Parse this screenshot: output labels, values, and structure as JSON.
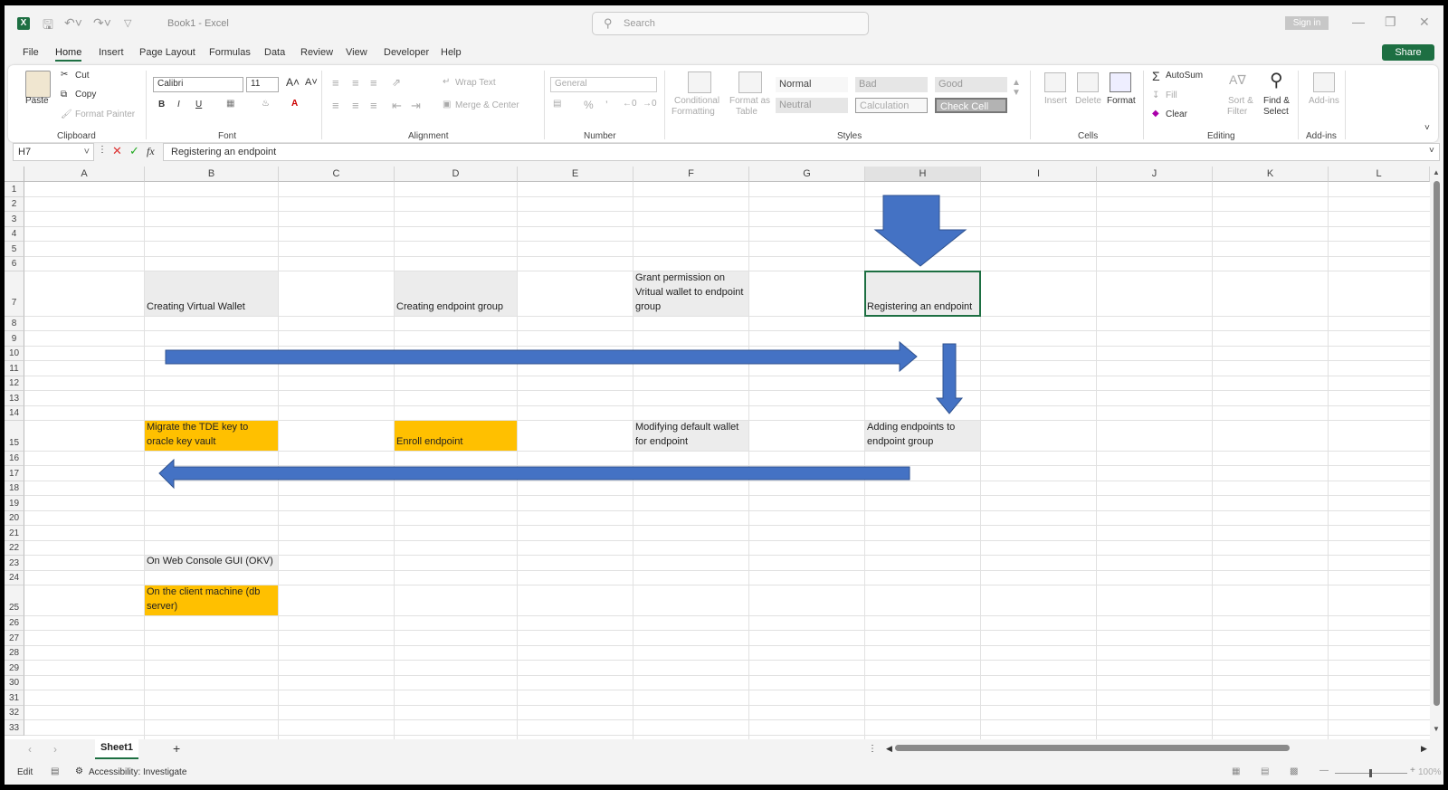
{
  "app": {
    "title": "Book1  -  Excel",
    "logo_letter": "X"
  },
  "search": {
    "placeholder": "Search"
  },
  "account": {
    "signin_label": "Sign in"
  },
  "menu": [
    "File",
    "Home",
    "Insert",
    "Page Layout",
    "Formulas",
    "Data",
    "Review",
    "View",
    "Developer",
    "Help"
  ],
  "share_label": "Share",
  "ribbon": {
    "clipboard": {
      "paste": "Paste",
      "cut": "Cut",
      "copy": "Copy",
      "format_painter": "Format Painter",
      "group": "Clipboard"
    },
    "font": {
      "name": "Calibri",
      "size": "11",
      "group": "Font"
    },
    "alignment": {
      "wrap_text": "Wrap Text",
      "merge_center": "Merge & Center",
      "group": "Alignment"
    },
    "number": {
      "format": "General",
      "group": "Number"
    },
    "styles": {
      "conditional": "Conditional",
      "formatting": "Formatting",
      "format_as": "Format as",
      "table": "Table",
      "normal": "Normal",
      "bad": "Bad",
      "good": "Good",
      "neutral": "Neutral",
      "calculation": "Calculation",
      "check_cell": "Check Cell",
      "group": "Styles"
    },
    "cells": {
      "insert": "Insert",
      "delete": "Delete",
      "format": "Format",
      "group": "Cells"
    },
    "editing": {
      "autosum": "AutoSum",
      "fill": "Fill",
      "clear": "Clear",
      "sort": "Sort &",
      "filter": "Filter",
      "find": "Find &",
      "select": "Select",
      "group": "Editing"
    },
    "addins": {
      "label": "Add-ins",
      "group": "Add-ins"
    }
  },
  "formula_bar": {
    "name_box": "H7",
    "fx": "fx",
    "value": "Registering an endpoint"
  },
  "columns": [
    "A",
    "B",
    "C",
    "D",
    "E",
    "F",
    "G",
    "H",
    "I",
    "J",
    "K",
    "L"
  ],
  "rows": [
    "1",
    "2",
    "3",
    "4",
    "5",
    "6",
    "7",
    "8",
    "9",
    "10",
    "11",
    "12",
    "13",
    "14",
    "15",
    "16",
    "17",
    "18",
    "19",
    "20",
    "21",
    "22",
    "23",
    "24",
    "25",
    "26",
    "27",
    "28",
    "29",
    "30",
    "31",
    "32",
    "33"
  ],
  "cells": {
    "b7": "Creating Virtual Wallet",
    "d7": "Creating endpoint group",
    "f7": "Grant permission on Vritual wallet to endpoint group",
    "h7": "Registering an endpoint",
    "b15": "Migrate the TDE key to oracle key vault",
    "d15": "Enroll endpoint",
    "f15": "Modifying default wallet for endpoint",
    "h15": "Adding endpoints to endpoint group",
    "b23": "On Web Console GUI (OKV)",
    "b25": "On the client machine (db server)"
  },
  "colors": {
    "excel_green": "#1d6f42",
    "arrow_blue": "#4472c4",
    "orange": "#ffc000",
    "gray_cell": "#ececec"
  },
  "sheets": [
    "Sheet1"
  ],
  "status": {
    "mode": "Edit",
    "accessibility": "Accessibility: Investigate",
    "zoom": "100%"
  }
}
